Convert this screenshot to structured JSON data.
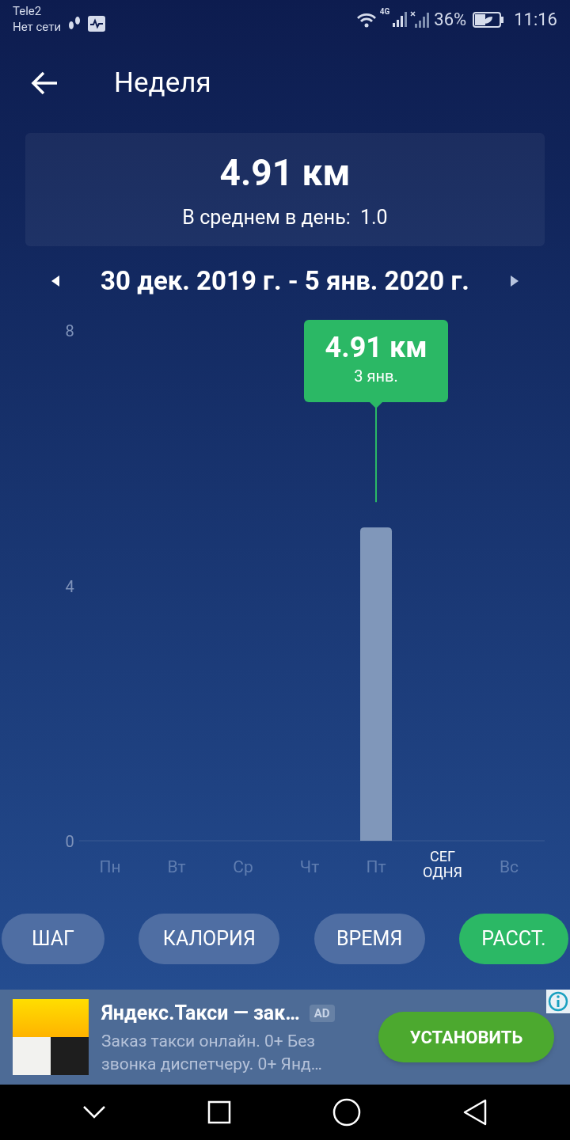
{
  "status_bar": {
    "carrier": "Tele2",
    "network": "Нет сети",
    "network_type": "4G",
    "battery": "36%",
    "time": "11:16"
  },
  "header": {
    "title": "Неделя"
  },
  "summary": {
    "total": "4.91 км",
    "average_label": "В среднем в день:",
    "average_value": "1.0"
  },
  "period": {
    "label": "30 дек. 2019 г. - 5 янв. 2020 г."
  },
  "chart": {
    "tooltip": {
      "value": "4.91 км",
      "date": "3 янв."
    },
    "days": [
      {
        "today": false
      },
      {
        "today": false
      },
      {
        "today": false
      },
      {
        "today": false
      },
      {
        "today": false
      },
      {
        "today": true
      },
      {
        "today": false
      }
    ],
    "chart_data": {
      "type": "bar",
      "categories": [
        "Пн",
        "Вт",
        "Ср",
        "Чт",
        "Пт",
        "СЕГ ОДНЯ",
        "Вс"
      ],
      "values": [
        0,
        0,
        0,
        0,
        4.91,
        0,
        0
      ],
      "ylim": [
        0,
        8
      ],
      "yticks": [
        0,
        4,
        8
      ]
    }
  },
  "metric_tabs": [
    {
      "label": "ШАГ",
      "selected": false
    },
    {
      "label": "КАЛОРИЯ",
      "selected": false
    },
    {
      "label": "ВРЕМЯ",
      "selected": false
    },
    {
      "label": "РАССТ.",
      "selected": true
    }
  ],
  "ad": {
    "title": "Яндекс.Такси — зак…",
    "badge": "AD",
    "description": "Заказ такси онлайн. 0+ Без звонка диспетчеру. 0+ Янд…",
    "button": "УСТАНОВИТЬ"
  }
}
